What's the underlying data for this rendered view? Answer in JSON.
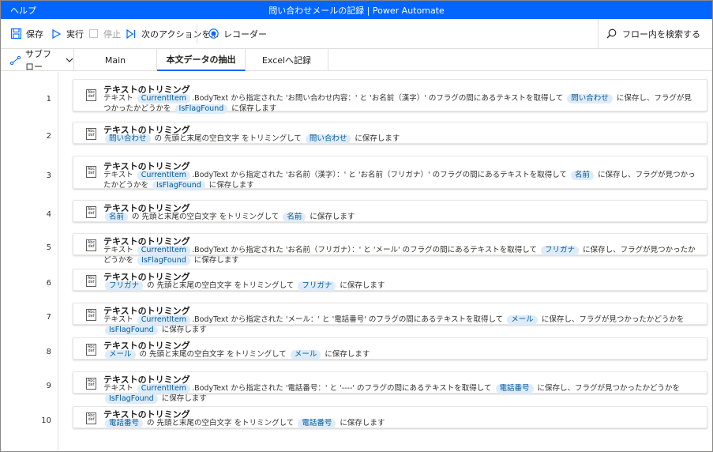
{
  "app": {
    "menu_help": "ヘルプ",
    "window_title": "問い合わせメールの記録 | Power Automate"
  },
  "toolbar": {
    "save": "保存",
    "run": "実行",
    "stop": "停止",
    "next_action": "次のアクションを...",
    "recorder": "レコーダー",
    "search": "フロー内を検索する"
  },
  "tabs": {
    "subflow": "サブフロー",
    "items": [
      "Main",
      "本文データの抽出",
      "Excelへ記録"
    ],
    "active": 1
  },
  "actions": [
    {
      "n": "1",
      "title": "テキストのトリミング",
      "desc": [
        [
          "t",
          "テキスト "
        ],
        [
          "v",
          "CurrentItem"
        ],
        [
          "t",
          ".BodyText から指定された 'お問い合わせ内容：' と 'お名前（漢字）' のフラグの間にあるテキストを取得して "
        ],
        [
          "v",
          "問い合わせ"
        ],
        [
          "t",
          " に保存し、フラグが見つかったかどうかを "
        ],
        [
          "v",
          "IsFlagFound"
        ],
        [
          "t",
          " に保存します"
        ]
      ]
    },
    {
      "n": "2",
      "title": "テキストのトリミング",
      "desc": [
        [
          "v",
          "問い合わせ"
        ],
        [
          "t",
          " の 先頭と末尾の空白文字 をトリミングして "
        ],
        [
          "v",
          "問い合わせ"
        ],
        [
          "t",
          " に保存します"
        ]
      ]
    },
    {
      "n": "3",
      "title": "テキストのトリミング",
      "desc": [
        [
          "t",
          "テキスト "
        ],
        [
          "v",
          "CurrentItem"
        ],
        [
          "t",
          ".BodyText から指定された 'お名前（漢字）：' と 'お名前（フリガナ）' のフラグの間にあるテキストを取得して "
        ],
        [
          "v",
          "名前"
        ],
        [
          "t",
          " に保存し、フラグが見つかったかどうかを "
        ],
        [
          "v",
          "IsFlagFound"
        ],
        [
          "t",
          " に保存します"
        ]
      ]
    },
    {
      "n": "4",
      "title": "テキストのトリミング",
      "desc": [
        [
          "v",
          "名前"
        ],
        [
          "t",
          " の 先頭と末尾の空白文字 をトリミングして "
        ],
        [
          "v",
          "名前"
        ],
        [
          "t",
          " に保存します"
        ]
      ]
    },
    {
      "n": "5",
      "title": "テキストのトリミング",
      "desc": [
        [
          "t",
          "テキスト "
        ],
        [
          "v",
          "CurrentItem"
        ],
        [
          "t",
          ".BodyText から指定された 'お名前（フリガナ）：' と 'メール' のフラグの間にあるテキストを取得して "
        ],
        [
          "v",
          "フリガナ"
        ],
        [
          "t",
          " に保存し、フラグが見つかったかどうかを "
        ],
        [
          "v",
          "IsFlagFound"
        ],
        [
          "t",
          " に保存します"
        ]
      ]
    },
    {
      "n": "6",
      "title": "テキストのトリミング",
      "desc": [
        [
          "v",
          "フリガナ"
        ],
        [
          "t",
          " の 先頭と末尾の空白文字 をトリミングして "
        ],
        [
          "v",
          "フリガナ"
        ],
        [
          "t",
          " に保存します"
        ]
      ]
    },
    {
      "n": "7",
      "title": "テキストのトリミング",
      "desc": [
        [
          "t",
          "テキスト "
        ],
        [
          "v",
          "CurrentItem"
        ],
        [
          "t",
          ".BodyText から指定された 'メール：' と '電話番号' のフラグの間にあるテキストを取得して "
        ],
        [
          "v",
          "メール"
        ],
        [
          "t",
          " に保存し、フラグが見つかったかどうかを "
        ],
        [
          "v",
          "IsFlagFound"
        ],
        [
          "t",
          " に保存します"
        ]
      ]
    },
    {
      "n": "8",
      "title": "テキストのトリミング",
      "desc": [
        [
          "v",
          "メール"
        ],
        [
          "t",
          " の 先頭と末尾の空白文字 をトリミングして "
        ],
        [
          "v",
          "メール"
        ],
        [
          "t",
          " に保存します"
        ]
      ]
    },
    {
      "n": "9",
      "title": "テキストのトリミング",
      "desc": [
        [
          "t",
          "テキスト "
        ],
        [
          "v",
          "CurrentItem"
        ],
        [
          "t",
          ".BodyText から指定された '電話番号：' と '----' のフラグの間にあるテキストを取得して "
        ],
        [
          "v",
          "電話番号"
        ],
        [
          "t",
          " に保存し、フラグが見つかったかどうかを "
        ],
        [
          "v",
          "IsFlagFound"
        ],
        [
          "t",
          " に保存します"
        ]
      ]
    },
    {
      "n": "10",
      "title": "テキストのトリミング",
      "desc": [
        [
          "v",
          "電話番号"
        ],
        [
          "t",
          " の 先頭と末尾の空白文字 をトリミングして "
        ],
        [
          "v",
          "電話番号"
        ],
        [
          "t",
          " に保存します"
        ]
      ]
    }
  ],
  "icon_label": "Abc\ndef",
  "colors": {
    "accent": "#0066ff",
    "chip_bg": "#deecf9",
    "chip_fg": "#005a9e"
  }
}
